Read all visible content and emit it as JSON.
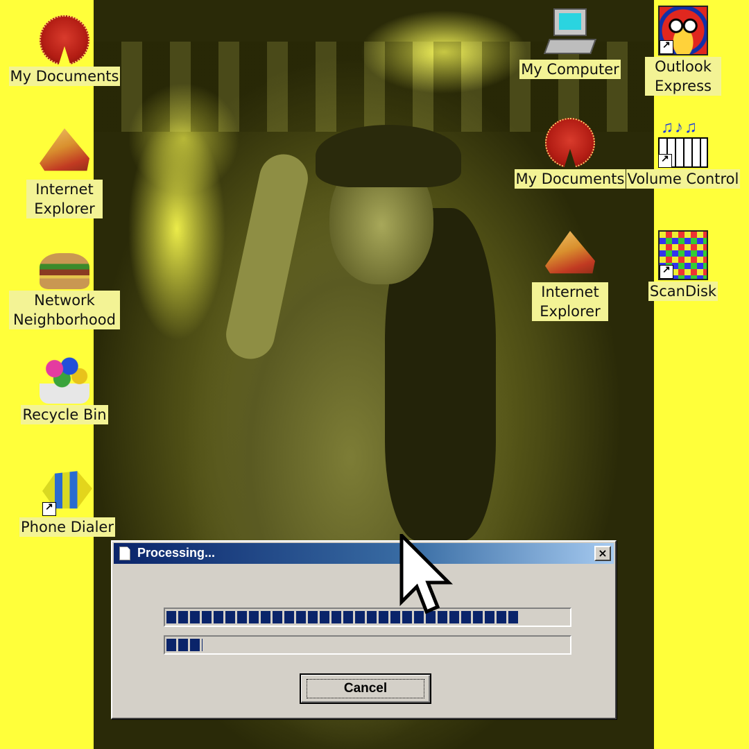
{
  "desktop": {
    "left_icons": [
      {
        "label": "My Documents",
        "icon": "my-documents-pie-icon"
      },
      {
        "label": "Internet Explorer",
        "icon": "internet-explorer-pie-slice-icon"
      },
      {
        "label": "Network Neighborhood",
        "icon": "network-neighborhood-burger-icon"
      },
      {
        "label": "Recycle Bin",
        "icon": "recycle-bin-flowers-icon"
      },
      {
        "label": "Phone Dialer",
        "icon": "phone-dialer-fish-icon"
      }
    ],
    "right_icons": [
      {
        "label": "My Computer",
        "icon": "my-computer-icon"
      },
      {
        "label": "My Documents",
        "icon": "my-documents-pie-icon"
      },
      {
        "label": "Internet Explorer",
        "icon": "internet-explorer-pie-slice-icon"
      },
      {
        "label": "Outlook Express",
        "icon": "outlook-express-mask-icon"
      },
      {
        "label": "Volume Control",
        "icon": "volume-control-piano-icon"
      },
      {
        "label": "ScanDisk",
        "icon": "scandisk-icon"
      }
    ]
  },
  "dialog": {
    "title": "Processing...",
    "progress_primary": 0.88,
    "progress_secondary": 0.09,
    "cancel_label": "Cancel",
    "close_label": "×"
  },
  "colors": {
    "desktop_background": "#ffff3a",
    "title_bar_start": "#0a246a",
    "progress_fill": "#0a246a",
    "dialog_face": "#d4d0c8"
  }
}
